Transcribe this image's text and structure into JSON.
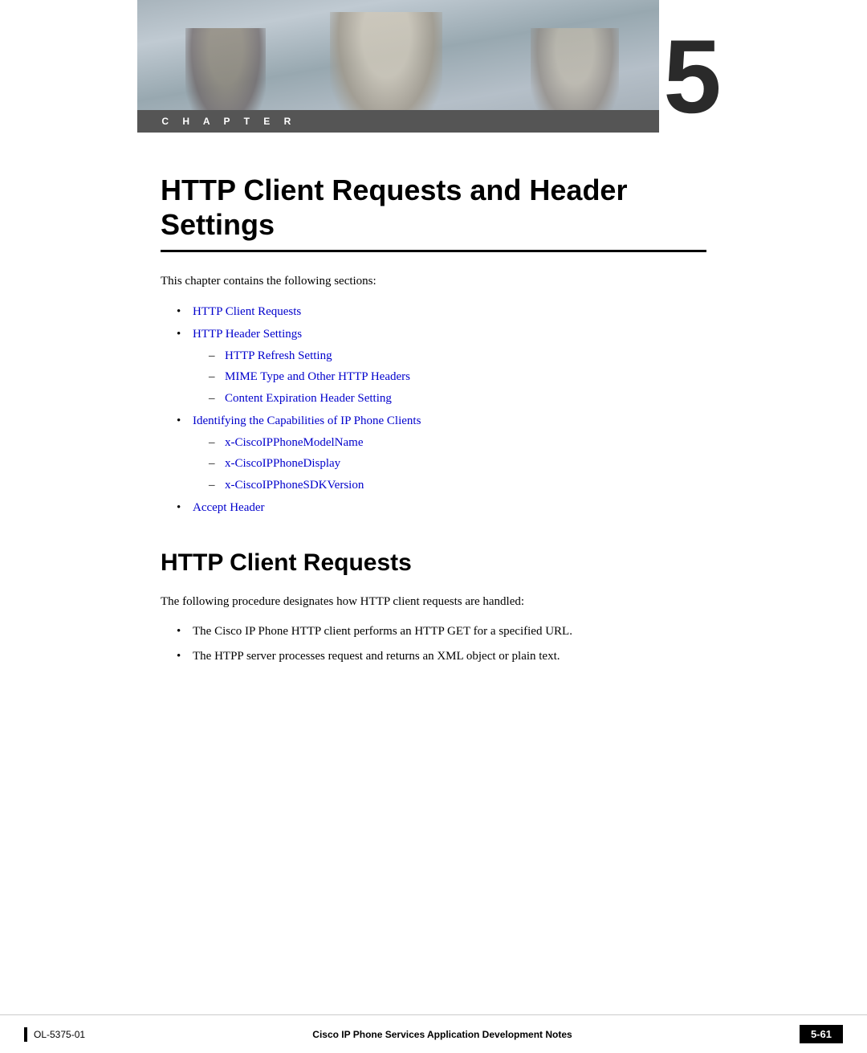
{
  "page": {
    "background_color": "#ffffff"
  },
  "header": {
    "chapter_label": "C H A P T E R",
    "chapter_number": "5"
  },
  "chapter_title": "HTTP Client Requests and Header Settings",
  "intro_text": "This chapter contains the following sections:",
  "toc": {
    "items": [
      {
        "label": "HTTP Client Requests",
        "subitems": []
      },
      {
        "label": "HTTP Header Settings",
        "subitems": [
          "HTTP Refresh Setting",
          "MIME Type and Other HTTP Headers",
          "Content Expiration Header Setting"
        ]
      },
      {
        "label": "Identifying the Capabilities of IP Phone Clients",
        "subitems": [
          "x-CiscoIPPhoneModelName",
          "x-CiscoIPPhoneDisplay",
          "x-CiscoIPPhoneSDKVersion"
        ]
      },
      {
        "label": "Accept Header",
        "subitems": []
      }
    ]
  },
  "section1": {
    "heading": "HTTP Client Requests",
    "intro": "The following procedure designates how HTTP client requests are handled:",
    "bullets": [
      "The Cisco IP Phone HTTP client performs an HTTP GET for a specified URL.",
      "The HTPP server processes request and returns an XML object or plain text."
    ]
  },
  "footer": {
    "left_label": "OL-5375-01",
    "center_label": "Cisco IP Phone Services Application Development Notes",
    "right_label": "5-61"
  }
}
